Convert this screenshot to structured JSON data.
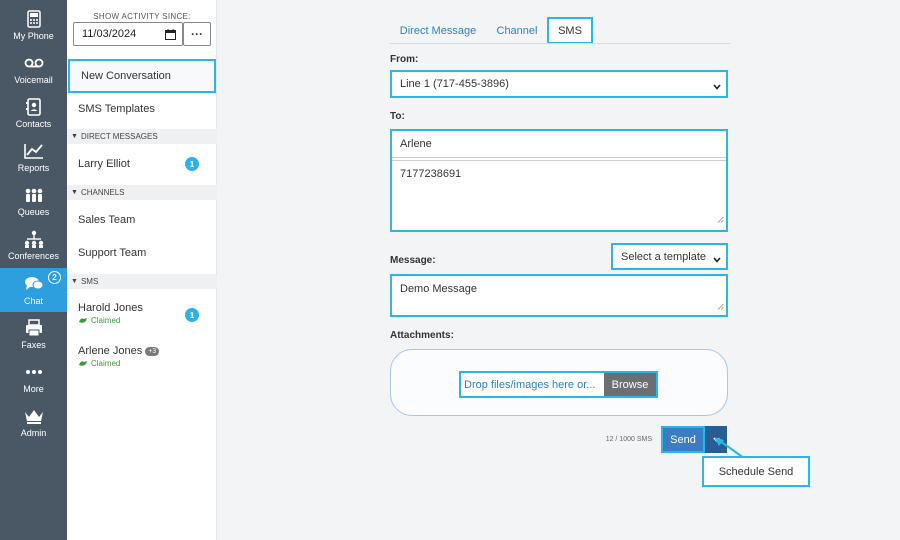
{
  "rail": {
    "items": [
      {
        "label": "My Phone",
        "icon": "phone-icon"
      },
      {
        "label": "Voicemail",
        "icon": "voicemail-icon"
      },
      {
        "label": "Contacts",
        "icon": "contacts-icon"
      },
      {
        "label": "Reports",
        "icon": "reports-icon"
      },
      {
        "label": "Queues",
        "icon": "queues-icon"
      },
      {
        "label": "Conferences",
        "icon": "conferences-icon"
      },
      {
        "label": "Chat",
        "icon": "chat-icon",
        "badge": "2"
      },
      {
        "label": "Faxes",
        "icon": "fax-icon"
      },
      {
        "label": "More",
        "icon": "more-icon"
      },
      {
        "label": "Admin",
        "icon": "crown-icon"
      }
    ],
    "bg_color": "#4a5866",
    "active_color": "#2d9fdf"
  },
  "sidebar": {
    "since_label": "SHOW ACTIVITY SINCE:",
    "date_value": "11/03/2024",
    "more_label": "···",
    "new_conversation": "New Conversation",
    "sms_templates": "SMS Templates",
    "direct_messages_header": "DIRECT MESSAGES",
    "direct_messages": [
      {
        "name": "Larry Elliot",
        "badge": "1"
      }
    ],
    "channels_header": "CHANNELS",
    "channels": [
      {
        "name": "Sales Team"
      },
      {
        "name": "Support Team"
      }
    ],
    "sms_header": "SMS",
    "sms": [
      {
        "name": "Harold Jones",
        "status": "Claimed",
        "badge": "1"
      },
      {
        "name": "Arlene Jones",
        "status": "Claimed",
        "extra": "+3"
      }
    ]
  },
  "tabs": {
    "direct_message": "Direct Message",
    "channel": "Channel",
    "sms": "SMS"
  },
  "form": {
    "from_label": "From:",
    "from_value": "Line 1 (717-455-3896)",
    "to_label": "To:",
    "to_name": "Arlene",
    "to_number": "7177238691",
    "message_label": "Message:",
    "template_placeholder": "Select a template",
    "message_value": "Demo Message",
    "attachments_label": "Attachments:",
    "drop_text": "Drop files/images here or...",
    "browse_label": "Browse",
    "sms_count": "12 / 1000 SMS",
    "send_label": "Send",
    "schedule_label": "Schedule Send"
  },
  "colors": {
    "highlight": "#29b6e8",
    "link": "#2d7fc1",
    "send": "#3a7dc2",
    "send_dropdown": "#2a5d93",
    "claimed": "#3a9a3a"
  }
}
